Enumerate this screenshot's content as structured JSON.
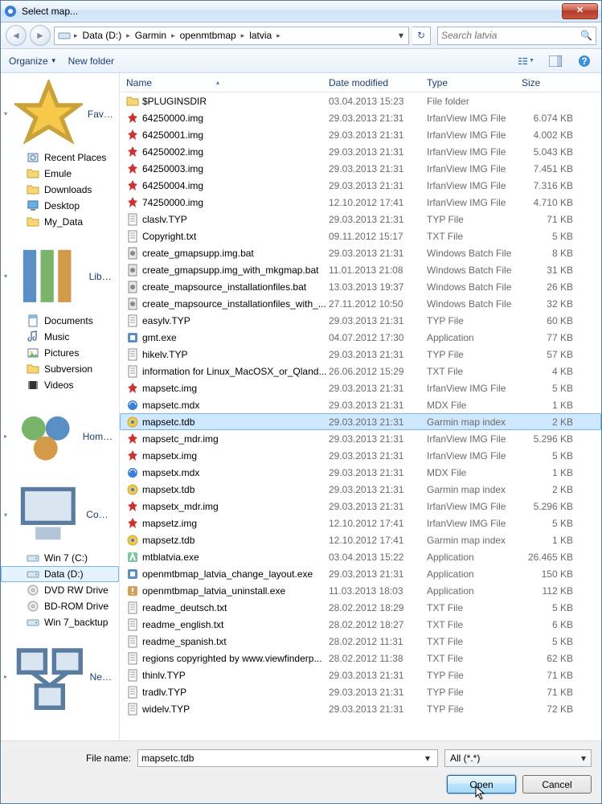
{
  "window": {
    "title": "Select map..."
  },
  "breadcrumb": {
    "segs": [
      "Data (D:)",
      "Garmin",
      "openmtbmap",
      "latvia"
    ],
    "search_placeholder": "Search latvia"
  },
  "toolbar": {
    "organize": "Organize",
    "newfolder": "New folder"
  },
  "nav": {
    "favorites": {
      "label": "Favorites",
      "items": [
        {
          "label": "Recent Places",
          "icon": "recent"
        },
        {
          "label": "Emule",
          "icon": "folder"
        },
        {
          "label": "Downloads",
          "icon": "folder"
        },
        {
          "label": "Desktop",
          "icon": "desktop"
        },
        {
          "label": "My_Data",
          "icon": "folder"
        }
      ]
    },
    "libraries": {
      "label": "Libraries",
      "items": [
        {
          "label": "Documents",
          "icon": "doc"
        },
        {
          "label": "Music",
          "icon": "music"
        },
        {
          "label": "Pictures",
          "icon": "pic"
        },
        {
          "label": "Subversion",
          "icon": "folder"
        },
        {
          "label": "Videos",
          "icon": "video"
        }
      ]
    },
    "homegroup": {
      "label": "Homegroup"
    },
    "computer": {
      "label": "Computer",
      "items": [
        {
          "label": "Win 7 (C:)",
          "icon": "drive"
        },
        {
          "label": "Data (D:)",
          "icon": "drive",
          "selected": true
        },
        {
          "label": "DVD RW Drive",
          "icon": "disc"
        },
        {
          "label": "BD-ROM Drive",
          "icon": "disc"
        },
        {
          "label": "Win 7_backtup",
          "icon": "drive"
        }
      ]
    },
    "network": {
      "label": "Network"
    }
  },
  "columns": {
    "name": "Name",
    "date": "Date modified",
    "type": "Type",
    "size": "Size"
  },
  "files": [
    {
      "name": "$PLUGINSDIR",
      "date": "03.04.2013 15:23",
      "type": "File folder",
      "size": "",
      "icon": "folder"
    },
    {
      "name": "64250000.img",
      "date": "29.03.2013 21:31",
      "type": "IrfanView IMG File",
      "size": "6.074 KB",
      "icon": "img"
    },
    {
      "name": "64250001.img",
      "date": "29.03.2013 21:31",
      "type": "IrfanView IMG File",
      "size": "4.002 KB",
      "icon": "img"
    },
    {
      "name": "64250002.img",
      "date": "29.03.2013 21:31",
      "type": "IrfanView IMG File",
      "size": "5.043 KB",
      "icon": "img"
    },
    {
      "name": "64250003.img",
      "date": "29.03.2013 21:31",
      "type": "IrfanView IMG File",
      "size": "7.451 KB",
      "icon": "img"
    },
    {
      "name": "64250004.img",
      "date": "29.03.2013 21:31",
      "type": "IrfanView IMG File",
      "size": "7.316 KB",
      "icon": "img"
    },
    {
      "name": "74250000.img",
      "date": "12.10.2012 17:41",
      "type": "IrfanView IMG File",
      "size": "4.710 KB",
      "icon": "img"
    },
    {
      "name": "claslv.TYP",
      "date": "29.03.2013 21:31",
      "type": "TYP File",
      "size": "71 KB",
      "icon": "txt"
    },
    {
      "name": "Copyright.txt",
      "date": "09.11.2012 15:17",
      "type": "TXT File",
      "size": "5 KB",
      "icon": "txt"
    },
    {
      "name": "create_gmapsupp.img.bat",
      "date": "29.03.2013 21:31",
      "type": "Windows Batch File",
      "size": "8 KB",
      "icon": "bat"
    },
    {
      "name": "create_gmapsupp.img_with_mkgmap.bat",
      "date": "11.01.2013 21:08",
      "type": "Windows Batch File",
      "size": "31 KB",
      "icon": "bat"
    },
    {
      "name": "create_mapsource_installationfiles.bat",
      "date": "13.03.2013 19:37",
      "type": "Windows Batch File",
      "size": "26 KB",
      "icon": "bat"
    },
    {
      "name": "create_mapsource_installationfiles_with_...",
      "date": "27.11.2012 10:50",
      "type": "Windows Batch File",
      "size": "32 KB",
      "icon": "bat"
    },
    {
      "name": "easylv.TYP",
      "date": "29.03.2013 21:31",
      "type": "TYP File",
      "size": "60 KB",
      "icon": "txt"
    },
    {
      "name": "gmt.exe",
      "date": "04.07.2012 17:30",
      "type": "Application",
      "size": "77 KB",
      "icon": "exe"
    },
    {
      "name": "hikelv.TYP",
      "date": "29.03.2013 21:31",
      "type": "TYP File",
      "size": "57 KB",
      "icon": "txt"
    },
    {
      "name": "information for Linux_MacOSX_or_Qland...",
      "date": "26.06.2012 15:29",
      "type": "TXT File",
      "size": "4 KB",
      "icon": "txt"
    },
    {
      "name": "mapsetc.img",
      "date": "29.03.2013 21:31",
      "type": "IrfanView IMG File",
      "size": "5 KB",
      "icon": "img"
    },
    {
      "name": "mapsetc.mdx",
      "date": "29.03.2013 21:31",
      "type": "MDX File",
      "size": "1 KB",
      "icon": "mdx"
    },
    {
      "name": "mapsetc.tdb",
      "date": "29.03.2013 21:31",
      "type": "Garmin map index",
      "size": "2 KB",
      "icon": "tdb",
      "selected": true
    },
    {
      "name": "mapsetc_mdr.img",
      "date": "29.03.2013 21:31",
      "type": "IrfanView IMG File",
      "size": "5.296 KB",
      "icon": "img"
    },
    {
      "name": "mapsetx.img",
      "date": "29.03.2013 21:31",
      "type": "IrfanView IMG File",
      "size": "5 KB",
      "icon": "img"
    },
    {
      "name": "mapsetx.mdx",
      "date": "29.03.2013 21:31",
      "type": "MDX File",
      "size": "1 KB",
      "icon": "mdx"
    },
    {
      "name": "mapsetx.tdb",
      "date": "29.03.2013 21:31",
      "type": "Garmin map index",
      "size": "2 KB",
      "icon": "tdb"
    },
    {
      "name": "mapsetx_mdr.img",
      "date": "29.03.2013 21:31",
      "type": "IrfanView IMG File",
      "size": "5.296 KB",
      "icon": "img"
    },
    {
      "name": "mapsetz.img",
      "date": "12.10.2012 17:41",
      "type": "IrfanView IMG File",
      "size": "5 KB",
      "icon": "img"
    },
    {
      "name": "mapsetz.tdb",
      "date": "12.10.2012 17:41",
      "type": "Garmin map index",
      "size": "1 KB",
      "icon": "tdb"
    },
    {
      "name": "mtblatvia.exe",
      "date": "03.04.2013 15:22",
      "type": "Application",
      "size": "26.465 KB",
      "icon": "exe2"
    },
    {
      "name": "openmtbmap_latvia_change_layout.exe",
      "date": "29.03.2013 21:31",
      "type": "Application",
      "size": "150 KB",
      "icon": "exe"
    },
    {
      "name": "openmtbmap_latvia_uninstall.exe",
      "date": "11.03.2013 18:03",
      "type": "Application",
      "size": "112 KB",
      "icon": "exe3"
    },
    {
      "name": "readme_deutsch.txt",
      "date": "28.02.2012 18:29",
      "type": "TXT File",
      "size": "5 KB",
      "icon": "txt"
    },
    {
      "name": "readme_english.txt",
      "date": "28.02.2012 18:27",
      "type": "TXT File",
      "size": "6 KB",
      "icon": "txt"
    },
    {
      "name": "readme_spanish.txt",
      "date": "28.02.2012 11:31",
      "type": "TXT File",
      "size": "5 KB",
      "icon": "txt"
    },
    {
      "name": "regions copyrighted by www.viewfinderp...",
      "date": "28.02.2012 11:38",
      "type": "TXT File",
      "size": "62 KB",
      "icon": "txt"
    },
    {
      "name": "thinlv.TYP",
      "date": "29.03.2013 21:31",
      "type": "TYP File",
      "size": "71 KB",
      "icon": "txt"
    },
    {
      "name": "tradlv.TYP",
      "date": "29.03.2013 21:31",
      "type": "TYP File",
      "size": "71 KB",
      "icon": "txt"
    },
    {
      "name": "widelv.TYP",
      "date": "29.03.2013 21:31",
      "type": "TYP File",
      "size": "72 KB",
      "icon": "txt"
    }
  ],
  "footer": {
    "fnlabel": "File name:",
    "fnvalue": "mapsetc.tdb",
    "filter": "All (*.*)",
    "open": "Open",
    "cancel": "Cancel"
  }
}
